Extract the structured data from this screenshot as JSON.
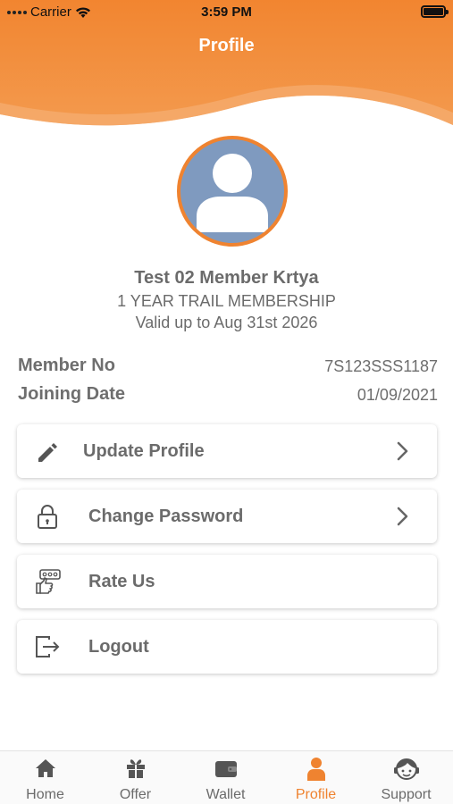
{
  "status_bar": {
    "carrier": "Carrier",
    "time": "3:59 PM"
  },
  "header": {
    "title": "Profile",
    "accent_color": "#ef8330"
  },
  "profile": {
    "name": "Test 02 Member Krtya",
    "plan": "1 YEAR TRAIL MEMBERSHIP",
    "valid": "Valid up to Aug 31st 2026",
    "avatar_icon": "person-icon"
  },
  "details": [
    {
      "label": "Member No",
      "value": "7S123SSS1187"
    },
    {
      "label": "Joining Date",
      "value": "01/09/2021"
    }
  ],
  "menu": [
    {
      "label": "Update Profile",
      "icon": "pencil-icon",
      "has_chevron": true
    },
    {
      "label": "Change Password",
      "icon": "lock-icon",
      "has_chevron": true
    },
    {
      "label": "Rate Us",
      "icon": "rate-icon",
      "has_chevron": false
    },
    {
      "label": "Logout",
      "icon": "logout-icon",
      "has_chevron": false
    }
  ],
  "tabs": [
    {
      "label": "Home",
      "icon": "home-icon",
      "active": false
    },
    {
      "label": "Offer",
      "icon": "gift-icon",
      "active": false
    },
    {
      "label": "Wallet",
      "icon": "wallet-icon",
      "active": false
    },
    {
      "label": "Profile",
      "icon": "person-icon",
      "active": true
    },
    {
      "label": "Support",
      "icon": "support-icon",
      "active": false
    }
  ]
}
